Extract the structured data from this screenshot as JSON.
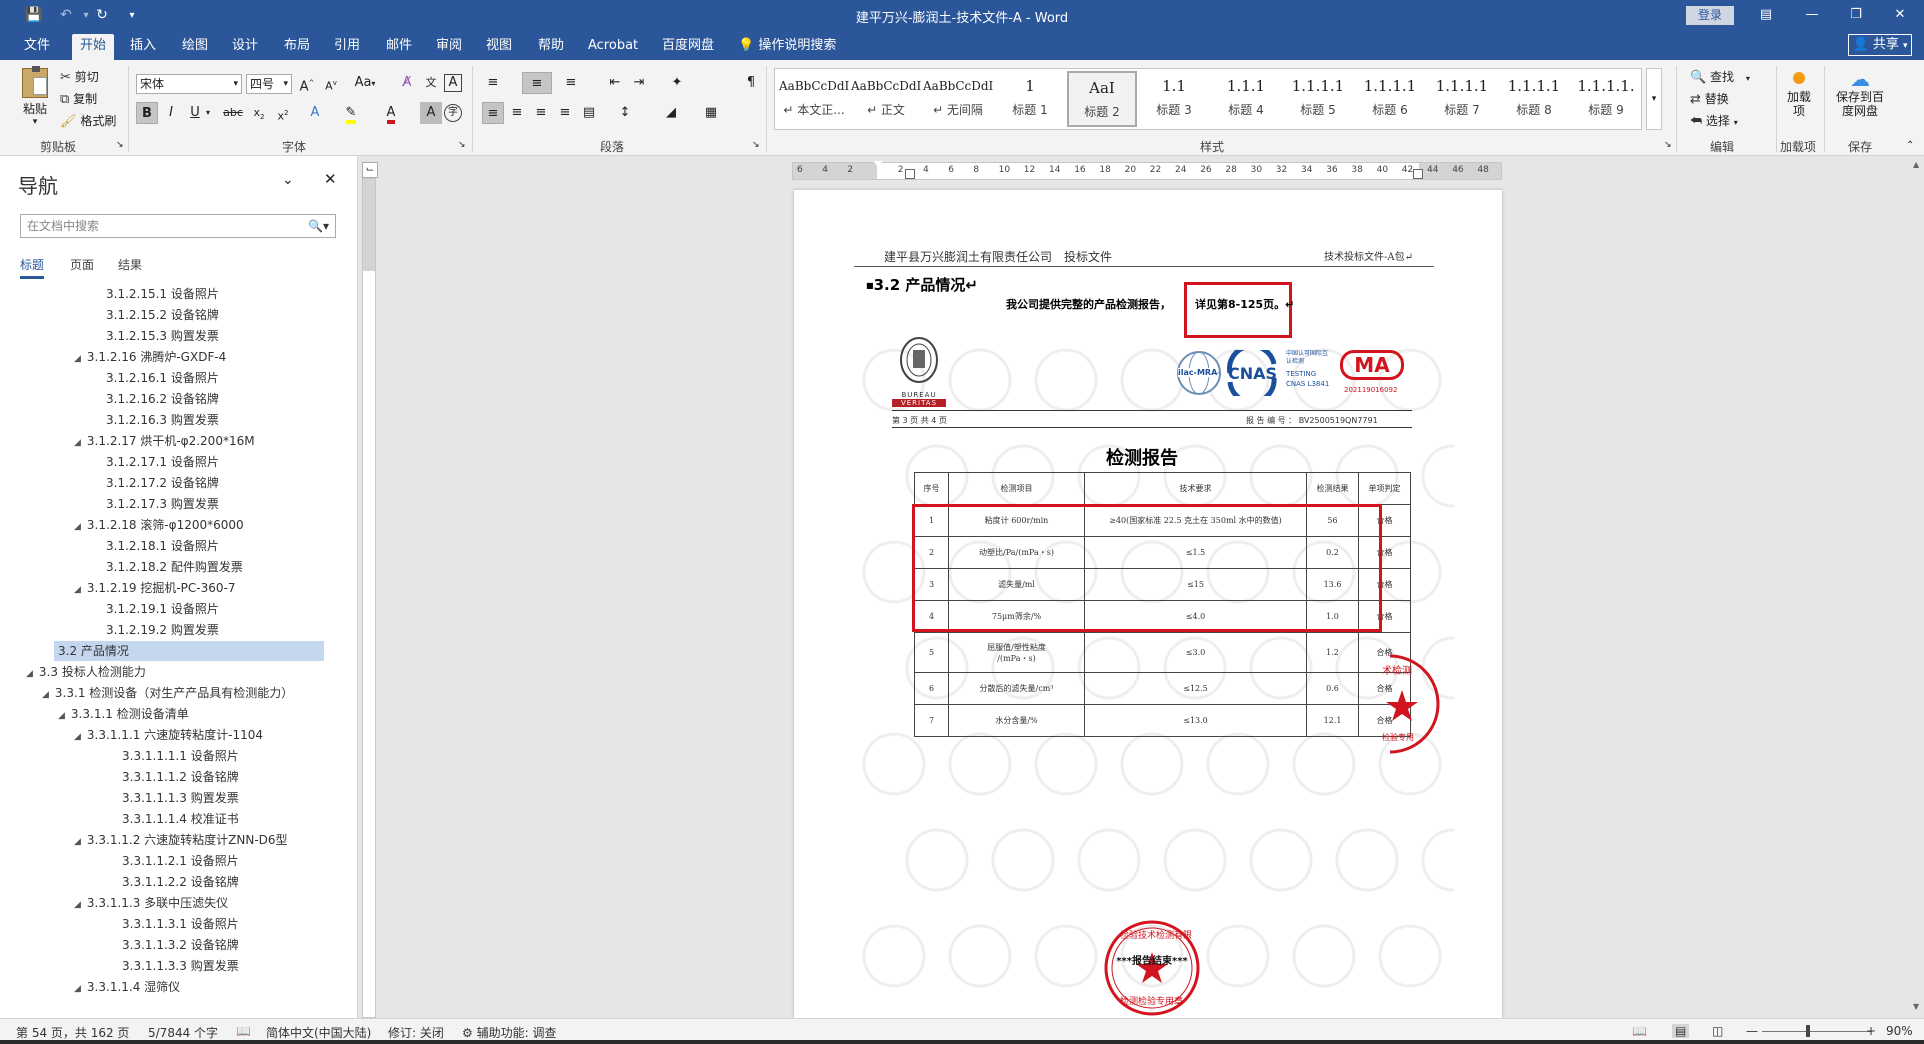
{
  "window": {
    "title": "建平万兴-膨润土-技术文件-A  -  Word",
    "login": "登录"
  },
  "tabs": [
    "文件",
    "开始",
    "插入",
    "绘图",
    "设计",
    "布局",
    "引用",
    "邮件",
    "审阅",
    "视图",
    "帮助",
    "Acrobat",
    "百度网盘"
  ],
  "active_tab": "开始",
  "tell_me": "操作说明搜索",
  "share": "共享",
  "ribbon": {
    "clipboard": {
      "paste": "粘贴",
      "cut": "剪切",
      "copy": "复制",
      "painter": "格式刷",
      "label": "剪贴板"
    },
    "font": {
      "name": "宋体",
      "size": "四号",
      "label": "字体"
    },
    "paragraph": {
      "label": "段落"
    },
    "styles": {
      "label": "样式",
      "items": [
        {
          "preview": "AaBbCcDdI",
          "name": "↵ 本文正..."
        },
        {
          "preview": "AaBbCcDdI",
          "name": "↵ 正文"
        },
        {
          "preview": "AaBbCcDdI",
          "name": "↵ 无间隔"
        },
        {
          "preview": "1",
          "name": "标题 1"
        },
        {
          "preview": "AaI",
          "name": "标题 2"
        },
        {
          "preview": "1.1",
          "name": "标题 3"
        },
        {
          "preview": "1.1.1",
          "name": "标题 4"
        },
        {
          "preview": "1.1.1.1",
          "name": "标题 5"
        },
        {
          "preview": "1.1.1.1",
          "name": "标题 6"
        },
        {
          "preview": "1.1.1.1",
          "name": "标题 7"
        },
        {
          "preview": "1.1.1.1",
          "name": "标题 8"
        },
        {
          "preview": "1.1.1.1.",
          "name": "标题 9"
        }
      ]
    },
    "editing": {
      "find": "查找",
      "replace": "替换",
      "select": "选择",
      "label": "编辑"
    },
    "addins": {
      "btn": "加载项",
      "label": "加载项"
    },
    "save": {
      "btn": "保存到百度网盘",
      "label": "保存"
    }
  },
  "nav": {
    "title": "导航",
    "search_placeholder": "在文档中搜索",
    "tabs": [
      "标题",
      "页面",
      "结果"
    ],
    "items": [
      {
        "text": "3.1.2.15.1 设备照片",
        "level": 5
      },
      {
        "text": "3.1.2.15.2 设备铭牌",
        "level": 5
      },
      {
        "text": "3.1.2.15.3 购置发票",
        "level": 5
      },
      {
        "text": "3.1.2.16 沸腾炉-GXDF-4",
        "level": 4,
        "expand": true
      },
      {
        "text": "3.1.2.16.1 设备照片",
        "level": 5
      },
      {
        "text": "3.1.2.16.2 设备铭牌",
        "level": 5
      },
      {
        "text": "3.1.2.16.3 购置发票",
        "level": 5
      },
      {
        "text": "3.1.2.17 烘干机-φ2.200*16M",
        "level": 4,
        "expand": true
      },
      {
        "text": "3.1.2.17.1 设备照片",
        "level": 5
      },
      {
        "text": "3.1.2.17.2 设备铭牌",
        "level": 5
      },
      {
        "text": "3.1.2.17.3 购置发票",
        "level": 5
      },
      {
        "text": "3.1.2.18 滚筛-φ1200*6000",
        "level": 4,
        "expand": true
      },
      {
        "text": "3.1.2.18.1 设备照片",
        "level": 5
      },
      {
        "text": "3.1.2.18.2 配件购置发票",
        "level": 5
      },
      {
        "text": "3.1.2.19 挖掘机-PC-360-7",
        "level": 4,
        "expand": true
      },
      {
        "text": "3.1.2.19.1 设备照片",
        "level": 5
      },
      {
        "text": "3.1.2.19.2 购置发票",
        "level": 5
      },
      {
        "text": "3.2 产品情况",
        "level": 2,
        "selected": true
      },
      {
        "text": "3.3 投标人检测能力",
        "level": 1,
        "expand": true
      },
      {
        "text": "3.3.1 检测设备（对生产产品具有检测能力）",
        "level": 2,
        "expand": true
      },
      {
        "text": "3.3.1.1 检测设备清单",
        "level": 3,
        "expand": true
      },
      {
        "text": "3.3.1.1.1 六速旋转粘度计-1104",
        "level": 4,
        "expand": true
      },
      {
        "text": "3.3.1.1.1.1 设备照片",
        "level": 6
      },
      {
        "text": "3.3.1.1.1.2 设备铭牌",
        "level": 6
      },
      {
        "text": "3.3.1.1.1.3 购置发票",
        "level": 6
      },
      {
        "text": "3.3.1.1.1.4 校准证书",
        "level": 6
      },
      {
        "text": "3.3.1.1.2 六速旋转粘度计ZNN-D6型",
        "level": 4,
        "expand": true
      },
      {
        "text": "3.3.1.1.2.1 设备照片",
        "level": 6
      },
      {
        "text": "3.3.1.1.2.2 设备铭牌",
        "level": 6
      },
      {
        "text": "3.3.1.1.3 多联中压滤失仪",
        "level": 4,
        "expand": true
      },
      {
        "text": "3.3.1.1.3.1 设备照片",
        "level": 6
      },
      {
        "text": "3.3.1.1.3.2 设备铭牌",
        "level": 6
      },
      {
        "text": "3.3.1.1.3.3 购置发票",
        "level": 6
      },
      {
        "text": "3.3.1.1.4 湿筛仪",
        "level": 4,
        "expand": true
      }
    ]
  },
  "ruler": [
    "6",
    "4",
    "2",
    "",
    "2",
    "4",
    "6",
    "8",
    "10",
    "12",
    "14",
    "16",
    "18",
    "20",
    "22",
    "24",
    "26",
    "28",
    "30",
    "32",
    "34",
    "36",
    "38",
    "40",
    "42",
    "44",
    "46",
    "48"
  ],
  "doc": {
    "header_left": "建平县万兴膨润土有限责任公司　投标文件",
    "header_right": "技术投标文件-A包↵",
    "heading": "3.2  产品情况↵",
    "intro": "我公司提供完整的产品检测报告，",
    "detail": "详见第8-125页。↵",
    "bv_text1": "BUREAU",
    "bv_text2": "VERITAS",
    "ilac": "ilac-MRA",
    "cnas": "CNAS",
    "cnas_cn": "中国认可国际互认检测",
    "cnas_testing": "TESTING",
    "cnas_no": "CNAS L3841",
    "ma": "MA",
    "ma_no": "202119016092",
    "page_info": "第 3 页 共 4 页",
    "report_no": "报 告 编 号 ： BV2500519QN7791",
    "report_title": "检测报告",
    "table": {
      "headers": [
        "序号",
        "检测项目",
        "技术要求",
        "检测结果",
        "单项判定"
      ],
      "rows": [
        [
          "1",
          "粘度计 600r/min",
          "≥40(国家标准 22.5 克土在 350ml 水中的数值)",
          "56",
          "合格"
        ],
        [
          "2",
          "动塑比/Pa/(mPa・s)",
          "≤1.5",
          "0.2",
          "合格"
        ],
        [
          "3",
          "滤失量/ml",
          "≤15",
          "13.6",
          "合格"
        ],
        [
          "4",
          "75μm筛余/%",
          "≤4.0",
          "1.0",
          "合格"
        ],
        [
          "5",
          "屈服值/塑性粘度\n/(mPa・s)",
          "≤3.0",
          "1.2",
          "合格"
        ],
        [
          "6",
          "分散后的滤失量/cm³",
          "≤12.5",
          "0.6",
          "合格"
        ],
        [
          "7",
          "水分含量/%",
          "≤13.0",
          "12.1",
          "合格"
        ]
      ]
    },
    "stamp_right": "术检测",
    "stamp_right2": "检验专用",
    "stamp_bottom_ring": "检验技术检测有限",
    "stamp_bottom_center": "***报告结束***",
    "stamp_bottom_label": "检测检验专用章"
  },
  "status": {
    "page": "第 54 页，共 162 页",
    "words": "5/7844 个字",
    "lang": "简体中文(中国大陆)",
    "track": "修订: 关闭",
    "access": "辅助功能: 调查",
    "zoom": "90%"
  },
  "colors": {
    "accent": "#2b579a",
    "red": "#d1141d",
    "cnas_blue": "#1a4f9c"
  }
}
